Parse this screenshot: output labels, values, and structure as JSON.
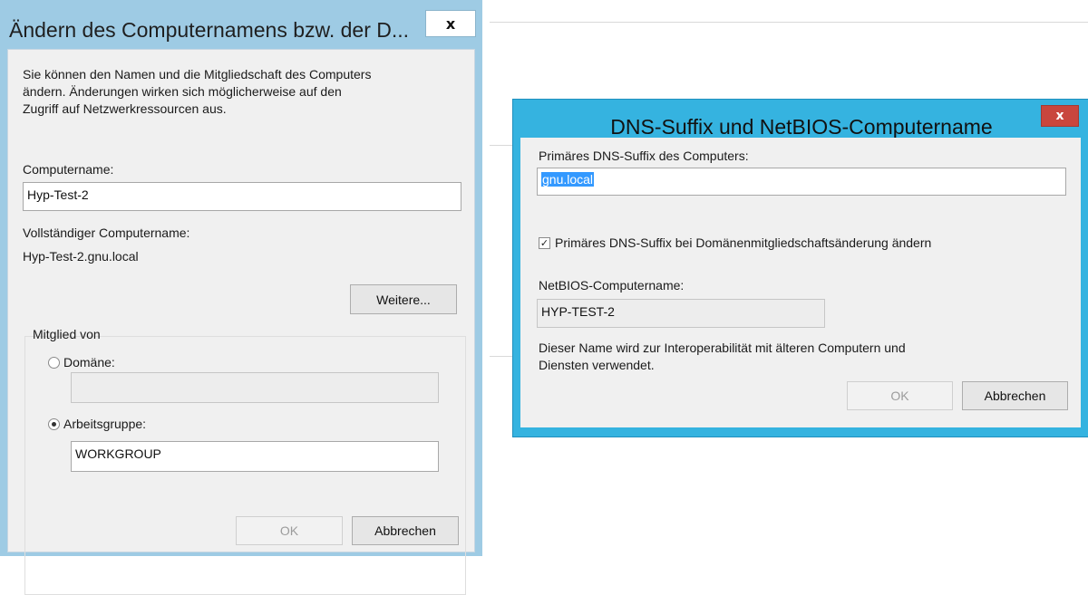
{
  "computer_name_dialog": {
    "title": "Ändern des Computernamens bzw. der D...",
    "close_label": "x",
    "description_lines": [
      "Sie können den Namen und die Mitgliedschaft des Computers",
      "ändern. Änderungen wirken sich möglicherweise auf den",
      "Zugriff auf Netzwerkressourcen aus."
    ],
    "computer_name_label": "Computername:",
    "computer_name_value": "Hyp-Test-2",
    "full_name_label": "Vollständiger Computername:",
    "full_name_value": "Hyp-Test-2.gnu.local",
    "more_button": "Weitere...",
    "member_of_label": "Mitglied von",
    "domain_label": "Domäne:",
    "domain_value": "",
    "domain_selected": false,
    "workgroup_label": "Arbeitsgruppe:",
    "workgroup_value": "WORKGROUP",
    "workgroup_selected": true,
    "ok_button": "OK",
    "cancel_button": "Abbrechen"
  },
  "dns_dialog": {
    "title": "DNS-Suffix und NetBIOS-Computername",
    "close_label": "x",
    "dns_suffix_label": "Primäres DNS-Suffix des Computers:",
    "dns_suffix_value": "gnu.local",
    "change_checkbox_label": "Primäres DNS-Suffix bei Domänenmitgliedschaftsänderung ändern",
    "change_checkbox_checked": true,
    "netbios_label": "NetBIOS-Computername:",
    "netbios_value": "HYP-TEST-2",
    "info_lines": [
      "Dieser Name wird zur Interoperabilität mit älteren Computern und",
      "Diensten verwendet."
    ],
    "ok_button": "OK",
    "cancel_button": "Abbrechen"
  },
  "colors": {
    "left_frame": "#9ecbe4",
    "right_frame": "#35b3e0",
    "close_red": "#c9463d",
    "selection": "#3399ff"
  }
}
